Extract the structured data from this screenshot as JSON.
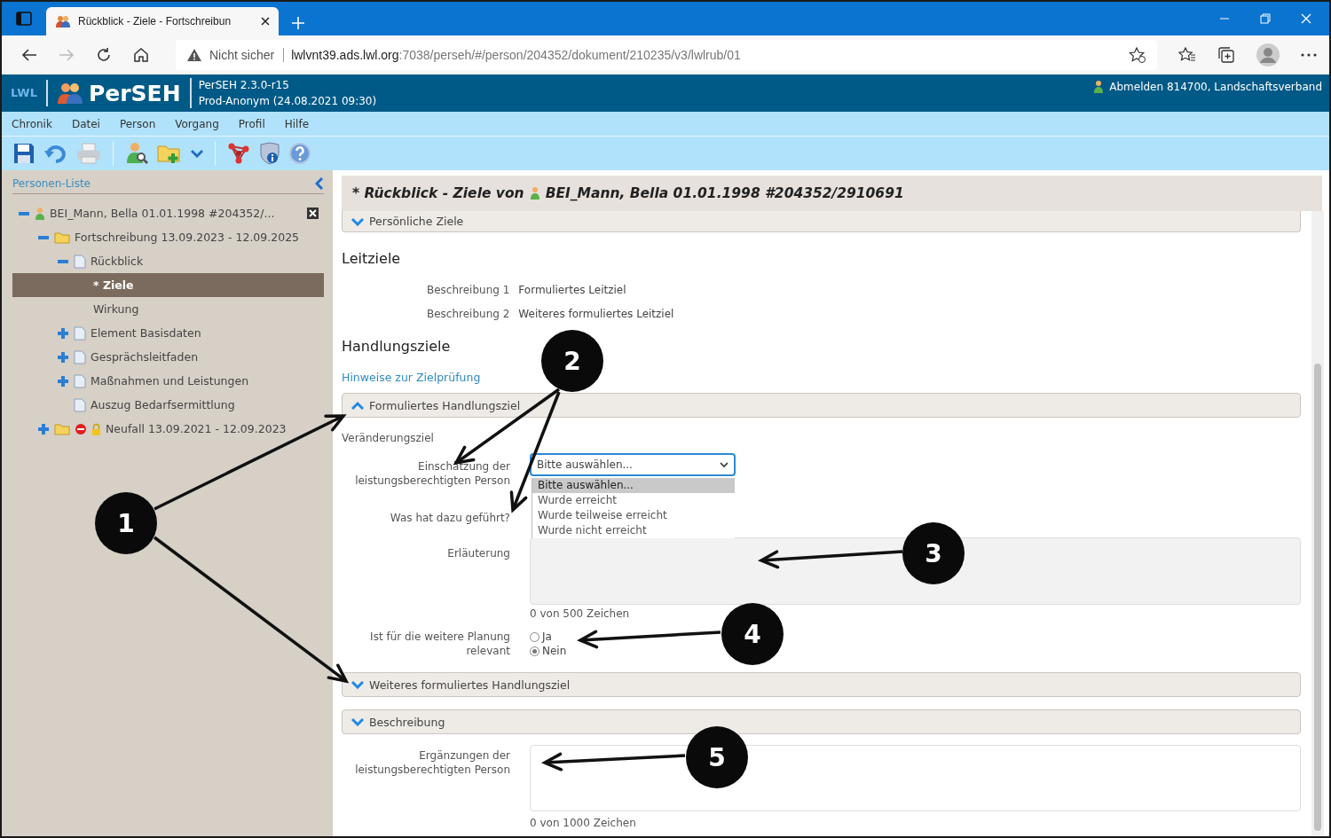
{
  "browser": {
    "tab_title": "Rückblick - Ziele - Fortschreibun",
    "security": "Nicht sicher",
    "url_host": "lwlvnt39.ads.lwl.org",
    "url_path": ":7038/perseh/#/person/204352/dokument/210235/v3/lwlrub/01"
  },
  "app_header": {
    "org": "LWL",
    "app_name": "PerSEH",
    "version": "PerSEH 2.3.0-r15",
    "environment": "Prod-Anonym (24.08.2021 09:30)",
    "user": "Abmelden 814700, Landschaftsverband"
  },
  "menu": [
    "Chronik",
    "Datei",
    "Person",
    "Vorgang",
    "Profil",
    "Hilfe"
  ],
  "sidebar": {
    "title": "Personen-Liste",
    "tree": [
      {
        "label": "BEI_Mann, Bella 01.01.1998 #204352/...",
        "kind": "person",
        "expanded": true,
        "selected": false,
        "children": [
          {
            "label": "Fortschreibung 13.09.2023 - 12.09.2025",
            "kind": "folder",
            "expanded": true,
            "selected": false,
            "children": [
              {
                "label": "Rückblick",
                "kind": "document",
                "expanded": true,
                "selected": false,
                "children": [
                  {
                    "label": "* Ziele",
                    "selected": true
                  },
                  {
                    "label": "Wirkung",
                    "selected": false
                  }
                ]
              },
              {
                "label": "Element Basisdaten",
                "kind": "document",
                "expanded": false,
                "selected": false
              },
              {
                "label": "Gesprächsleitfaden",
                "kind": "document",
                "expanded": false,
                "selected": false
              },
              {
                "label": "Maßnahmen und Leistungen",
                "kind": "document",
                "expanded": false,
                "selected": false
              },
              {
                "label": "Auszug Bedarfsermittlung",
                "kind": "document",
                "selected": false
              }
            ]
          },
          {
            "label": "Neufall 13.09.2021 - 12.09.2023",
            "kind": "folder-locked",
            "expanded": false,
            "selected": false
          }
        ]
      }
    ]
  },
  "document": {
    "title_prefix": "* Rückblick - Ziele von",
    "title_person": "BEI_Mann, Bella 01.01.1998 #204352/2910691",
    "personal_goals_panel": {
      "label": "Persönliche Ziele",
      "expanded": false
    },
    "leitziele": {
      "heading": "Leitziele",
      "rows": [
        {
          "label": "Beschreibung 1",
          "value": "Formuliertes Leitziel"
        },
        {
          "label": "Beschreibung 2",
          "value": "Weiteres formuliertes Leitziel"
        }
      ]
    },
    "handlungsziele": {
      "heading": "Handlungsziele",
      "link": "Hinweise zur Zielprüfung"
    },
    "goal_panel": {
      "label": "Formuliertes Handlungsziel",
      "expanded": true,
      "subheading": "Veränderungsziel",
      "assessment": {
        "label": "Einschätzung der leistungsberechtigten Person",
        "value": "Bitte auswählen...",
        "open": true,
        "options": [
          {
            "label": "Bitte auswählen...",
            "selected": true
          },
          {
            "label": "Wurde erreicht",
            "selected": false
          },
          {
            "label": "Wurde teilweise erreicht",
            "selected": false
          },
          {
            "label": "Wurde nicht erreicht",
            "selected": false
          }
        ]
      },
      "cause_label": "Was hat dazu geführt?",
      "explanation": {
        "label": "Erläuterung",
        "counter": "0 von 500 Zeichen"
      },
      "relevance": {
        "label": "Ist für die weitere Planung relevant",
        "options": [
          {
            "label": "Ja",
            "selected": false
          },
          {
            "label": "Nein",
            "selected": true
          }
        ]
      }
    },
    "further_goal_panel": {
      "label": "Weiteres formuliertes Handlungsziel",
      "expanded": false
    },
    "description_panel": {
      "label": "Beschreibung",
      "expanded": false,
      "field": {
        "label": "Ergänzungen der leistungsberechtigten Person",
        "counter": "0 von 1000 Zeichen"
      }
    }
  },
  "annotations": [
    {
      "number": "1"
    },
    {
      "number": "2"
    },
    {
      "number": "3"
    },
    {
      "number": "4"
    },
    {
      "number": "5"
    }
  ]
}
